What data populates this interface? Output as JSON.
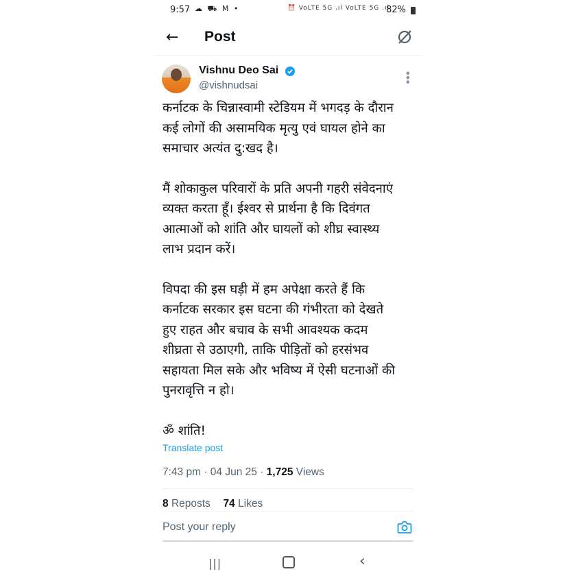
{
  "status_bar": {
    "time": "9:57",
    "left_icons": "☁ ⛟ M •",
    "right_icons": "⏰ VoLTE 5G .ıl VoLTE 5G .ıl",
    "battery": "82%"
  },
  "header": {
    "title": "Post"
  },
  "author": {
    "name": "Vishnu Deo Sai",
    "handle": "@vishnudsai"
  },
  "tweet": {
    "paragraphs": [
      [
        "कर्नाटक के चिन्नास्वामी स्टेडियम में भगदड़ के दौरान",
        "कई लोगों की असामयिक मृत्यु एवं घायल होने का",
        "समाचार अत्यंत दु:खद है।"
      ],
      [
        "मैं शोकाकुल परिवारों के प्रति अपनी गहरी संवेदनाएं",
        "व्यक्त करता हूँ। ईश्वर से प्रार्थना है कि दिवंगत",
        "आत्माओं को शांति और घायलों को शीघ्र स्वास्थ्य",
        "लाभ प्रदान करें।"
      ],
      [
        "विपदा की इस घड़ी में हम अपेक्षा करते हैं कि",
        "कर्नाटक सरकार इस घटना की गंभीरता को देखते",
        "हुए राहत और बचाव के सभी आवश्यक कदम",
        "शीघ्रता से उठाएगी, ताकि पीड़ितों को हरसंभव",
        "सहायता मिल सके और भविष्य में ऐसी घटनाओं की",
        "पुनरावृत्ति न हो।"
      ],
      [
        "ॐ शांति!"
      ]
    ],
    "translate_label": "Translate post",
    "time": "7:43 pm",
    "date": "04 Jun 25",
    "views_count": "1,725",
    "views_label": "Views"
  },
  "stats": {
    "reposts_count": "8",
    "reposts_label": "Reposts",
    "likes_count": "74",
    "likes_label": "Likes"
  },
  "reply": {
    "placeholder": "Post your reply"
  },
  "colors": {
    "accent": "#1d9bf0",
    "text": "#0f1419",
    "secondary": "#536471"
  }
}
